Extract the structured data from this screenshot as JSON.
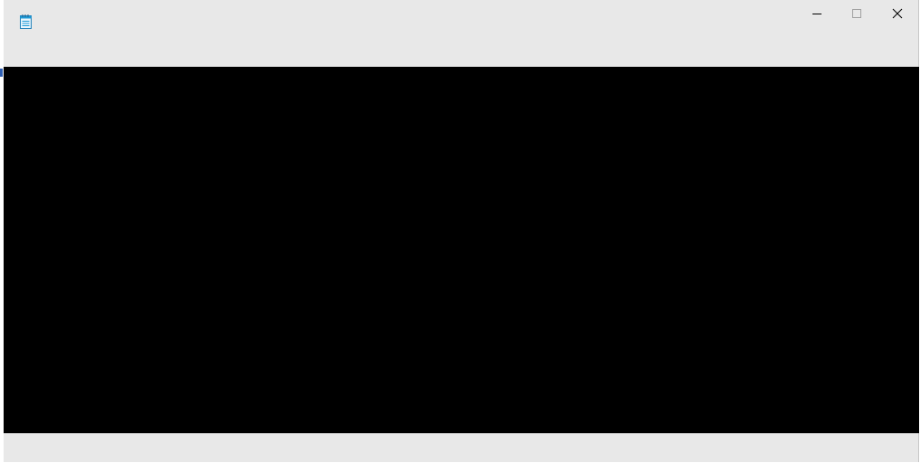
{
  "window": {
    "title": "",
    "icon": "notepad-icon",
    "controls": {
      "minimize_icon": "minimize-icon",
      "maximize_icon": "maximize-icon",
      "close_icon": "close-icon"
    }
  },
  "content": {
    "background": "#000000"
  },
  "colors": {
    "chrome": "#e8e8e8",
    "icon_accent": "#1e9ad6"
  }
}
